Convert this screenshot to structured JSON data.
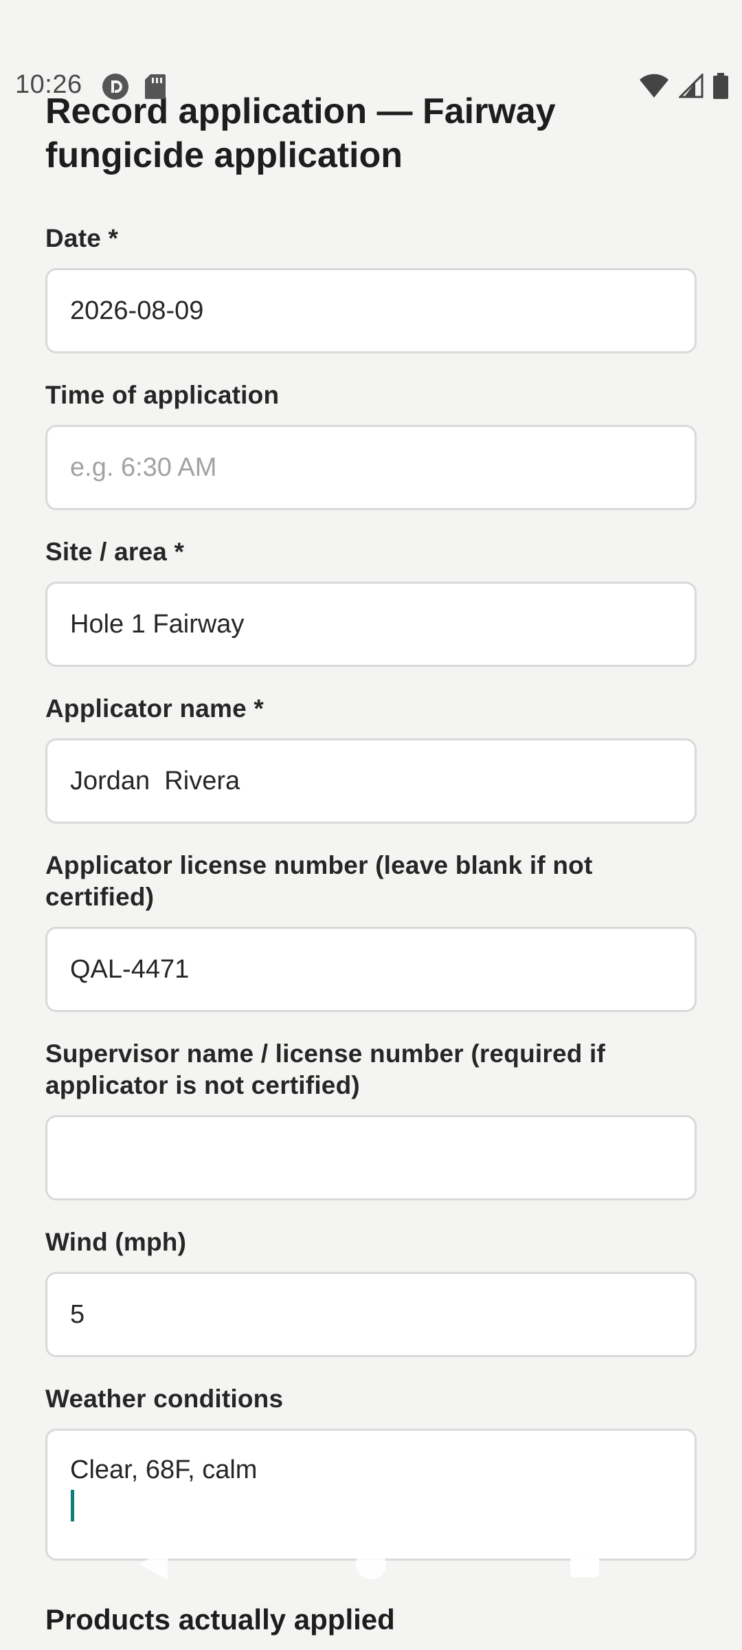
{
  "status_bar": {
    "time": "10:26",
    "left_icons": [
      "pocket-casts-icon",
      "sd-card-icon"
    ],
    "right_icons": [
      "wifi-icon",
      "cell-signal-icon",
      "battery-icon"
    ]
  },
  "page": {
    "title": "Record application — Fairway fungicide application"
  },
  "form": {
    "date": {
      "label": "Date *",
      "value": "2026-08-09"
    },
    "time_of_application": {
      "label": "Time of application",
      "placeholder": "e.g. 6:30 AM",
      "value": ""
    },
    "site_area": {
      "label": "Site / area *",
      "value": "Hole 1 Fairway"
    },
    "applicator_name": {
      "label": "Applicator name *",
      "value": "Jordan  Rivera"
    },
    "applicator_license": {
      "label": "Applicator license number (leave blank if not certified)",
      "value": "QAL-4471"
    },
    "supervisor": {
      "label": "Supervisor name / license number (required if applicator is not certified)",
      "value": ""
    },
    "wind": {
      "label": "Wind (mph)",
      "value": "5"
    },
    "weather": {
      "label": "Weather conditions",
      "value": "Clear, 68F, calm"
    }
  },
  "products_section": {
    "title": "Products actually applied"
  },
  "colors": {
    "background": "#f4f4f3",
    "input_border": "#d9d9d9",
    "caret": "#0f7d7a"
  },
  "nav_bar": {
    "icons": [
      "back-icon",
      "home-icon",
      "recents-icon"
    ]
  }
}
